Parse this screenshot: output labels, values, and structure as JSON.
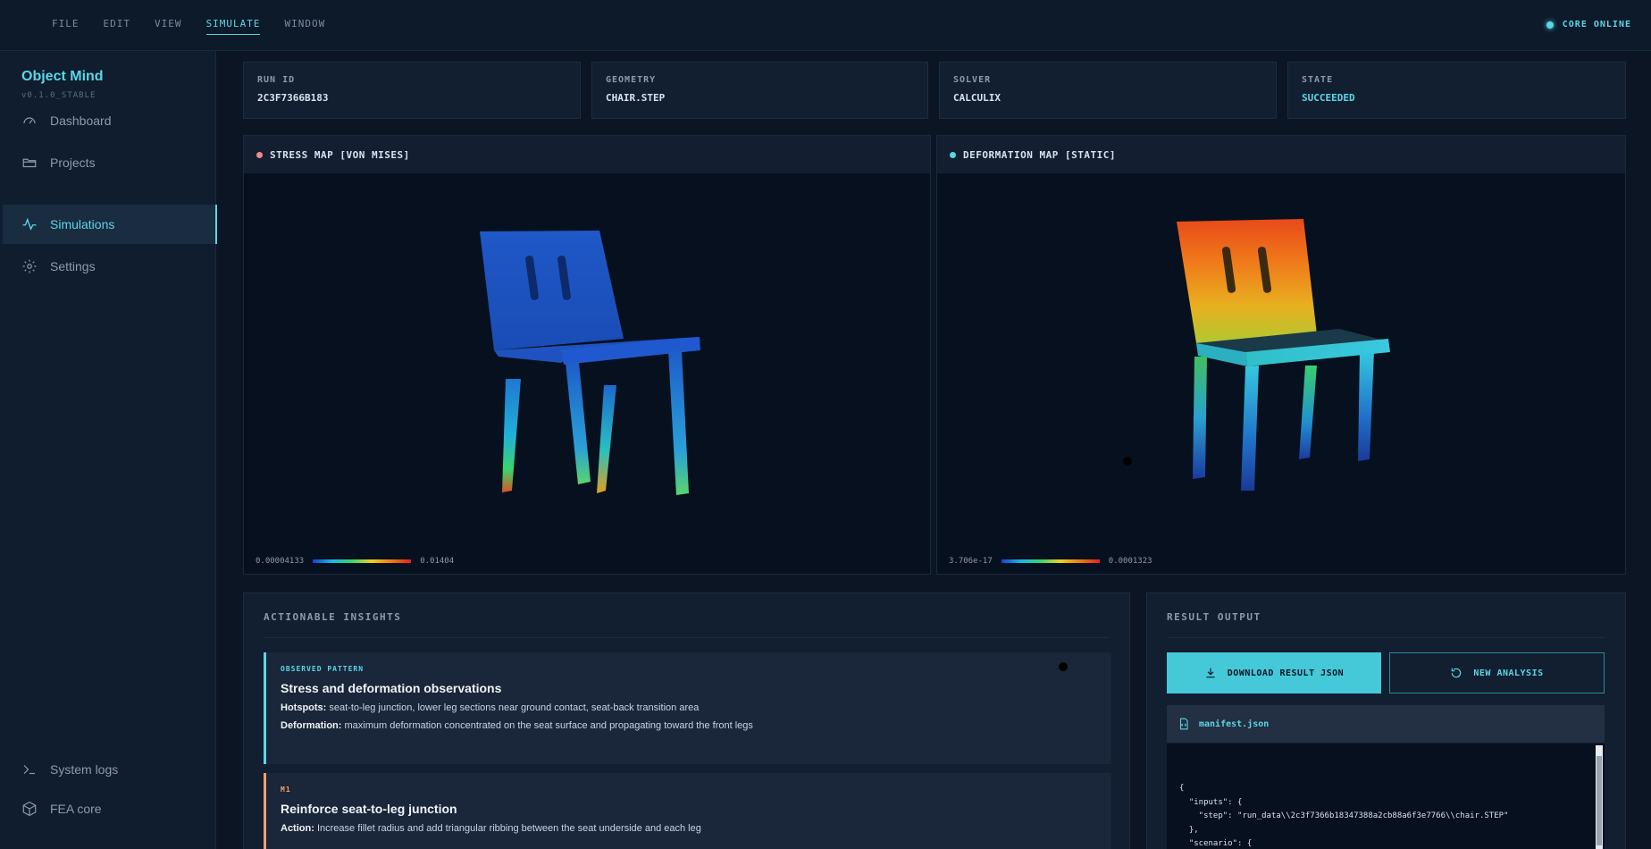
{
  "menu": [
    {
      "label": "FILE",
      "active": false
    },
    {
      "label": "EDIT",
      "active": false
    },
    {
      "label": "VIEW",
      "active": false
    },
    {
      "label": "SIMULATE",
      "active": true
    },
    {
      "label": "WINDOW",
      "active": false
    }
  ],
  "status": {
    "label": "CORE ONLINE"
  },
  "sidebar": {
    "brand": "Object Mind",
    "version": "v0.1.0_STABLE",
    "items": [
      {
        "label": "Dashboard",
        "icon": "gauge-icon"
      },
      {
        "label": "Projects",
        "icon": "folder-icon"
      },
      {
        "label": "Simulations",
        "icon": "pulse-icon",
        "active": true
      },
      {
        "label": "Settings",
        "icon": "gear-icon"
      }
    ],
    "footer": [
      {
        "label": "System logs",
        "icon": "terminal-icon"
      },
      {
        "label": "FEA core",
        "icon": "cube-icon"
      }
    ]
  },
  "run": {
    "run_id": {
      "label": "RUN ID",
      "value": "2C3F7366B183"
    },
    "geometry": {
      "label": "GEOMETRY",
      "value": "CHAIR.STEP"
    },
    "solver": {
      "label": "SOLVER",
      "value": "CALCULIX"
    },
    "state": {
      "label": "STATE",
      "value": "SUCCEEDED"
    }
  },
  "stress": {
    "title": "STRESS MAP [VON MISES]",
    "min": "0.00004133",
    "max": "0.01404",
    "dot_color": "#f08a8a"
  },
  "deformation": {
    "title": "DEFORMATION MAP [STATIC]",
    "min": "3.706e-17",
    "max": "0.0001323",
    "dot_color": "#5ad6e6"
  },
  "insights": {
    "title": "ACTIONABLE INSIGHTS",
    "pattern": {
      "tag": "OBSERVED PATTERN",
      "title": "Stress and deformation observations",
      "hotspots_label": "Hotspots:",
      "hotspots": "seat-to-leg junction, lower leg sections near ground contact, seat-back transition area",
      "deformation_label": "Deformation:",
      "deformation": "maximum deformation concentrated on the seat surface and propagating toward the front legs"
    },
    "m1": {
      "tag": "M1",
      "title": "Reinforce seat-to-leg junction",
      "action_label": "Action:",
      "action": "Increase fillet radius and add triangular ribbing between the seat underside and each leg"
    }
  },
  "result": {
    "title": "RESULT OUTPUT",
    "download": "DOWNLOAD RESULT JSON",
    "new_analysis": "NEW ANALYSIS",
    "file_name": "manifest.json",
    "code": "{\n  \"inputs\": {\n    \"step\": \"run_data\\\\2c3f7366b18347388a2cb88a6f3e7766\\\\chair.STEP\"\n  },\n  \"scenario\": {\n    \"step_path\": \"examples/chair.step\",\n    \"scenario\": {"
  }
}
